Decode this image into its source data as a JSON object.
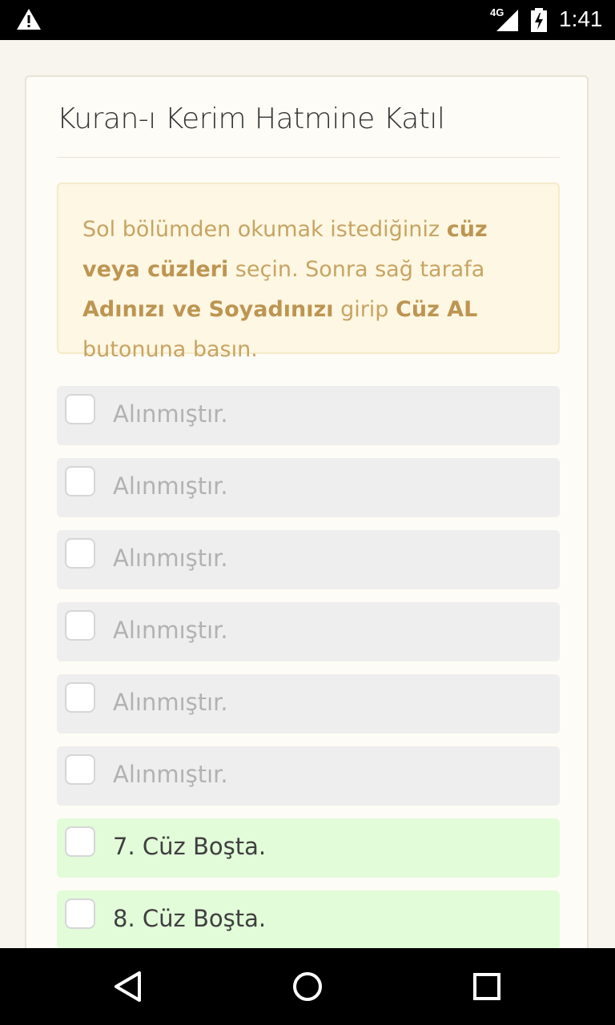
{
  "status_bar": {
    "network": "4G",
    "time": "1:41"
  },
  "card": {
    "title": "Kuran-ı Kerim Hatmine Katıl",
    "info": {
      "t1": "Sol bölümden okumak istediğiniz ",
      "b1": "cüz veya cüzleri",
      "t2": " seçin. Sonra sağ tarafa ",
      "b2": "Adınızı ve Soyadınızı",
      "t3": " girip ",
      "b3": "Cüz AL",
      "t4": " butonuna basın."
    }
  },
  "juz_list": [
    {
      "label": "Alınmıştır.",
      "status": "taken"
    },
    {
      "label": "Alınmıştır.",
      "status": "taken"
    },
    {
      "label": "Alınmıştır.",
      "status": "taken"
    },
    {
      "label": "Alınmıştır.",
      "status": "taken"
    },
    {
      "label": "Alınmıştır.",
      "status": "taken"
    },
    {
      "label": "Alınmıştır.",
      "status": "taken"
    },
    {
      "label": "7. Cüz Boşta.",
      "status": "free"
    },
    {
      "label": "8. Cüz Boşta.",
      "status": "free"
    }
  ],
  "nav_bar": {
    "icons": [
      "back-icon",
      "home-icon",
      "recents-icon"
    ]
  },
  "colors": {
    "taken_bg": "#eeeeee",
    "free_bg": "#e2fcd9",
    "info_bg": "#fdf7e3",
    "info_text": "#c7a463"
  }
}
